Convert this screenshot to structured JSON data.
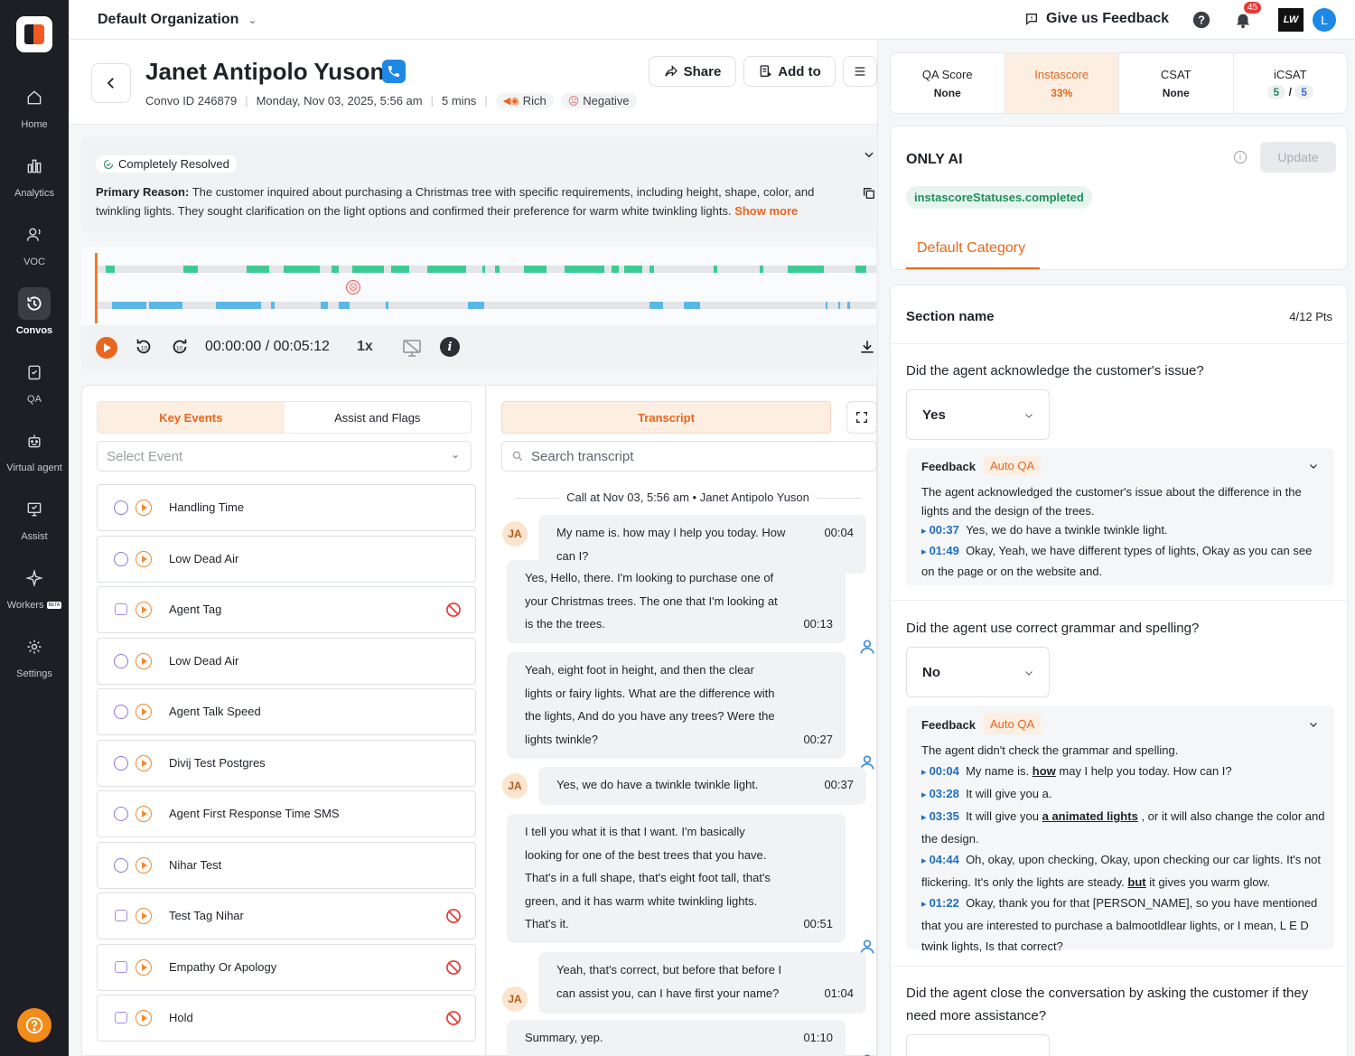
{
  "sidebar": {
    "items": [
      {
        "label": "Home",
        "icon": "home-icon"
      },
      {
        "label": "Analytics",
        "icon": "analytics-icon"
      },
      {
        "label": "VOC",
        "icon": "voc-icon"
      },
      {
        "label": "Convos",
        "icon": "convos-icon",
        "active": true
      },
      {
        "label": "QA",
        "icon": "qa-icon"
      },
      {
        "label": "Virtual agent",
        "icon": "virtual-agent-icon"
      },
      {
        "label": "Assist",
        "icon": "assist-icon"
      },
      {
        "label": "Workers",
        "icon": "workers-icon",
        "badge": "BETA"
      },
      {
        "label": "Settings",
        "icon": "settings-icon"
      }
    ]
  },
  "topbar": {
    "org": "Default Organization",
    "feedback": "Give us Feedback",
    "notif_count": "45",
    "avatar_letter": "L",
    "brand_badge": "LW"
  },
  "header": {
    "name": "Janet Antipolo Yuson",
    "convo_id": "Convo ID 246879",
    "datetime": "Monday, Nov 03, 2025, 5:56 am",
    "duration": "5 mins",
    "tag_rich": "Rich",
    "tag_sentiment": "Negative",
    "share_label": "Share",
    "addto_label": "Add to"
  },
  "summary": {
    "resolution": "Completely Resolved",
    "primary_label": "Primary Reason:",
    "primary_text": "The customer inquired about purchasing a Christmas tree with specific requirements, including height, shape, color, and twinkling lights. They sought clarification on the light options and confirmed their preference for warm white twinkling lights.",
    "show_more": "Show more"
  },
  "audio": {
    "timecode": "00:00:00 / 00:05:12",
    "speed": "1x"
  },
  "events": {
    "tabs": [
      "Key Events",
      "Assist and Flags"
    ],
    "select_placeholder": "Select Event",
    "items": [
      {
        "label": "Handling Time",
        "kind": "metric",
        "flag": false
      },
      {
        "label": "Low Dead Air",
        "kind": "metric",
        "flag": false
      },
      {
        "label": "Agent Tag",
        "kind": "tag",
        "flag": true
      },
      {
        "label": "Low Dead Air",
        "kind": "metric",
        "flag": false
      },
      {
        "label": "Agent Talk Speed",
        "kind": "metric",
        "flag": false
      },
      {
        "label": "Divij Test Postgres",
        "kind": "metric",
        "flag": false
      },
      {
        "label": "Agent First Response Time SMS",
        "kind": "metric",
        "flag": false
      },
      {
        "label": "Nihar Test",
        "kind": "metric",
        "flag": false
      },
      {
        "label": "Test Tag Nihar",
        "kind": "tag",
        "flag": true
      },
      {
        "label": "Empathy Or Apology",
        "kind": "tag",
        "flag": true
      },
      {
        "label": "Hold",
        "kind": "tag",
        "flag": true
      }
    ]
  },
  "transcript": {
    "tab": "Transcript",
    "search_placeholder": "Search transcript",
    "call_header": "Call at Nov 03, 5:56 am • Janet Antipolo Yuson",
    "customer_initials": "JA",
    "messages": [
      {
        "speaker": "customer",
        "text": "My name is. how may I help you today. How can I?",
        "time": "00:04"
      },
      {
        "speaker": "agent",
        "text": "Yes, Hello, there. I'm looking to purchase one of your Christmas trees. The one that I'm looking at is the the trees.",
        "time": "00:13"
      },
      {
        "speaker": "agent",
        "text": "Yeah, eight foot in height, and then the clear lights or fairy lights. What are the difference with the lights, And do you have any trees? Were the lights twinkle?",
        "time": "00:27"
      },
      {
        "speaker": "customer",
        "text": "Yes, we do have a twinkle twinkle light.",
        "time": "00:37"
      },
      {
        "speaker": "agent",
        "text": "I tell you what it is that I want. I'm basically looking for one of the best trees that you have. That's in a full shape, that's eight foot tall, that's green, and it has warm white twinkling lights. That's it.",
        "time": "00:51"
      },
      {
        "speaker": "customer",
        "text": "Yeah, that's correct, but before that before I can assist you, can I have first your name?",
        "time": "01:04"
      },
      {
        "speaker": "agent",
        "text": "Summary, yep.",
        "time": "01:10"
      }
    ]
  },
  "scores": [
    {
      "label": "QA Score",
      "value": "None"
    },
    {
      "label": "Instascore",
      "value": "33%",
      "active": true
    },
    {
      "label": "CSAT",
      "value": "None"
    },
    {
      "label": "iCSAT",
      "value_a": "5",
      "sep": "/",
      "value_b": "5"
    }
  ],
  "ai_card": {
    "title": "ONLY AI",
    "update_label": "Update",
    "status": "instascoreStatuses.completed",
    "category_tab": "Default Category"
  },
  "qa": {
    "section_name": "Section name",
    "section_points": "4/12 Pts",
    "feedback_label": "Feedback",
    "autoqa_label": "Auto QA",
    "q1": {
      "question": "Did the agent acknowledge the customer's issue?",
      "answer": "Yes",
      "feedback": "The agent acknowledged the customer's issue about the difference in the lights and the design of the trees.",
      "refs": [
        {
          "time": "00:37",
          "text": "Yes, we do have a twinkle twinkle light."
        },
        {
          "time": "01:49",
          "text": "Okay, Yeah, we have different types of lights, Okay as you can see on the page or on the website and."
        }
      ]
    },
    "q2": {
      "question": "Did the agent use correct grammar and spelling?",
      "answer": "No",
      "feedback": "The agent didn't check the grammar and spelling.",
      "refs": [
        {
          "time": "00:04",
          "pre": "My name is.",
          "hl": "how",
          "post": "may I help you today. How can I?"
        },
        {
          "time": "03:28",
          "pre": "It will give you a.",
          "hl": "",
          "post": ""
        },
        {
          "time": "03:35",
          "pre": "It will give you",
          "hl": "a animated lights",
          "post": ", or it will also change the color and the design."
        },
        {
          "time": "04:44",
          "pre": "Oh, okay, upon checking, Okay, upon checking our car lights. It's not flickering. It's only the lights are steady.",
          "hl": "but",
          "post": "it gives you warm glow."
        },
        {
          "time": "01:22",
          "pre": "Okay, thank you for that [PERSON_NAME], so you have mentioned that you are interested to purchase a balmootldlear lights, or I mean, L E D twink lights, Is that correct?",
          "hl": "",
          "post": ""
        }
      ]
    },
    "q3": {
      "question": "Did the agent close the conversation by asking the customer if they need more assistance?"
    }
  },
  "colors": {
    "accent": "#e8661d",
    "sidebar_bg": "#1d1f24",
    "agent_segment": "#3ccb94",
    "customer_segment": "#5ab8e6"
  }
}
